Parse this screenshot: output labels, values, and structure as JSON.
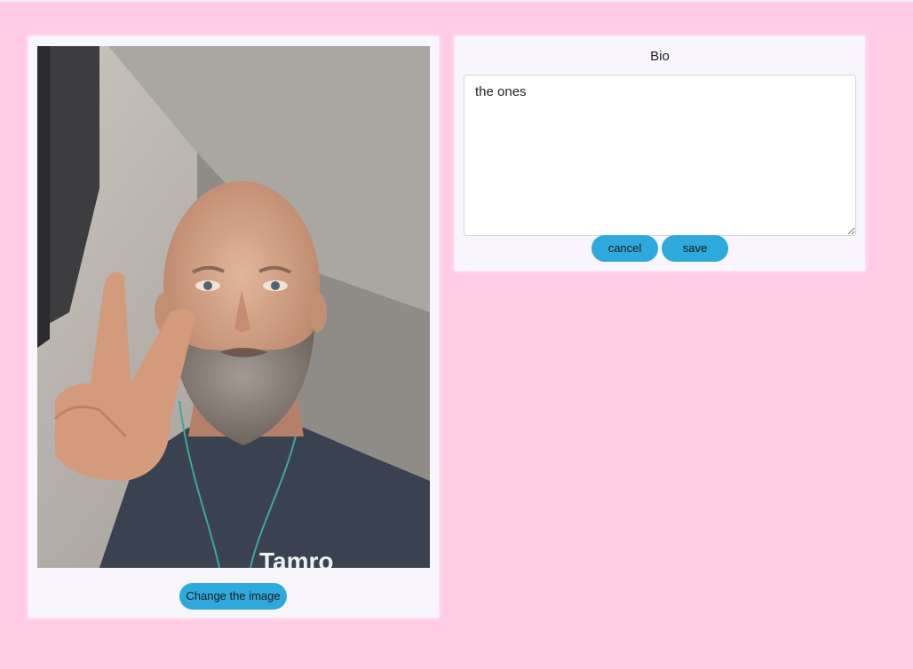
{
  "profile": {
    "change_image_label": "Change the image",
    "photo_icon": "profile-photo",
    "shirt_text": "Tamro"
  },
  "bio": {
    "title": "Bio",
    "text": "the ones",
    "cancel_label": "cancel",
    "save_label": "save"
  },
  "colors": {
    "background": "#ffcce3",
    "card": "#f8f5fc",
    "accent": "#2ea9db"
  }
}
